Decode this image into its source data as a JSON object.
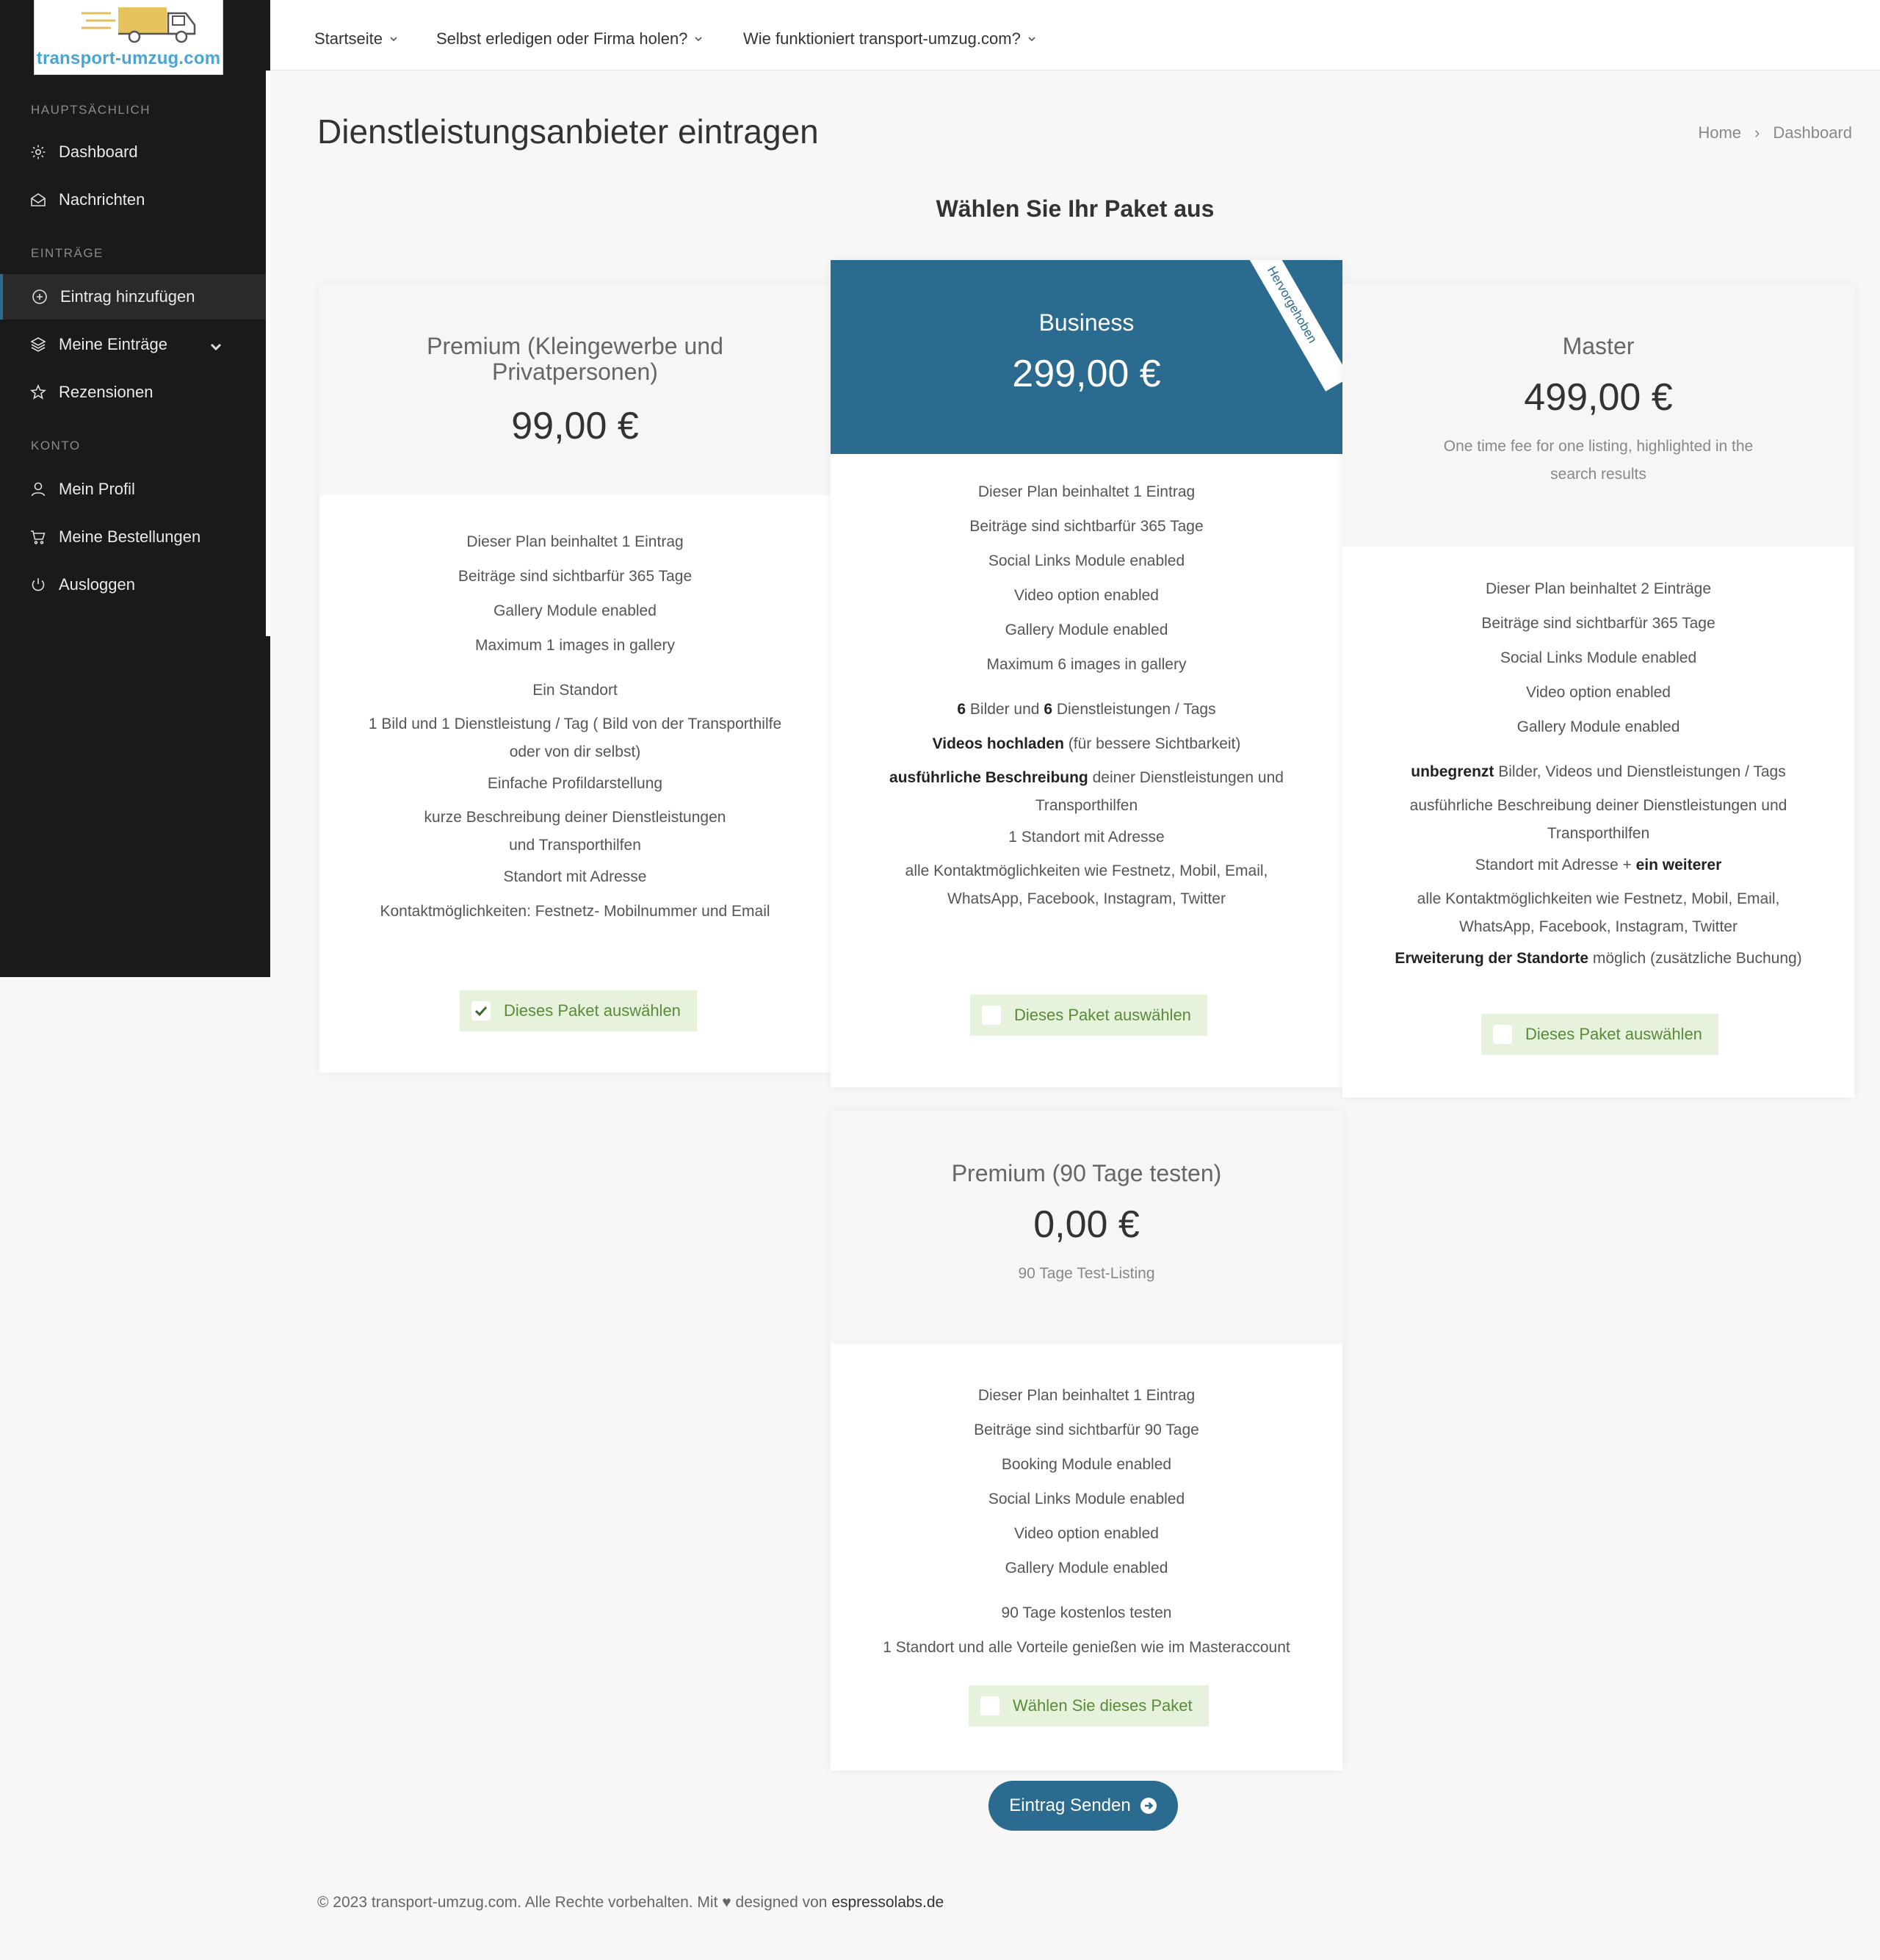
{
  "logo": {
    "text": "transport-umzug.com"
  },
  "sidebar": {
    "sections": {
      "main": "HAUPTSÄCHLICH",
      "entries": "EINTRÄGE",
      "account": "KONTO"
    },
    "items": {
      "dashboard": "Dashboard",
      "messages": "Nachrichten",
      "add_entry": "Eintrag hinzufügen",
      "my_entries": "Meine Einträge",
      "reviews": "Rezensionen",
      "profile": "Mein Profil",
      "orders": "Meine Bestellungen",
      "logout": "Ausloggen"
    }
  },
  "topnav": {
    "home": "Startseite",
    "diy": "Selbst erledigen oder Firma holen?",
    "how": "Wie funktioniert transport-umzug.com?"
  },
  "header": {
    "title": "Dienstleistungsanbieter eintragen",
    "breadcrumb_home": "Home",
    "breadcrumb_current": "Dashboard"
  },
  "section_title": "Wählen Sie Ihr Paket aus",
  "plans": {
    "premium": {
      "name_line1": "Premium (Kleingewerbe und",
      "name_line2": "Privatpersonen)",
      "price": "99,00 €",
      "f1": "Dieser Plan beinhaltet 1 Eintrag",
      "f2": "Beiträge sind sichtbarfür 365 Tage",
      "f3": "Gallery Module enabled",
      "f4": "Maximum 1 images in gallery",
      "f5": "Ein Standort",
      "f6a": "1 Bild und 1 Dienstleistung / Tag ( Bild von der Transporthilfe",
      "f6b": "oder von dir selbst)",
      "f7": "Einfache Profildarstellung",
      "f8a": "kurze Beschreibung deiner Dienstleistungen",
      "f8b": "und Transporthilfen",
      "f9": "Standort mit Adresse",
      "f10": "Kontaktmöglichkeiten: Festnetz- Mobilnummer und Email",
      "button": "Dieses Paket auswählen"
    },
    "business": {
      "ribbon": "Hervorgehoben",
      "name": "Business",
      "price": "299,00 €",
      "f1": "Dieser Plan beinhaltet 1 Eintrag",
      "f2": "Beiträge sind sichtbarfür 365 Tage",
      "f3": "Social Links Module enabled",
      "f4": "Video option enabled",
      "f5": "Gallery Module enabled",
      "f6": "Maximum 6 images in gallery",
      "f7_b1": "6",
      "f7_t1": " Bilder und ",
      "f7_b2": "6",
      "f7_t2": " Dienstleistungen / Tags",
      "f8_b": "Videos hochladen",
      "f8_t": " (für bessere Sichtbarkeit)",
      "f9_b": "ausführliche Beschreibung",
      "f9_t": " deiner Dienstleistungen und",
      "f9_t2": "Transporthilfen",
      "f10": "1 Standort mit Adresse",
      "f11a": "alle Kontaktmöglichkeiten wie Festnetz, Mobil, Email,",
      "f11b": "WhatsApp, Facebook, Instagram, Twitter",
      "button": "Dieses Paket auswählen"
    },
    "master": {
      "name": "Master",
      "price": "499,00 €",
      "desc1": "One time fee for one listing, highlighted in the",
      "desc2": "search results",
      "f1": "Dieser Plan beinhaltet 2 Einträge",
      "f2": "Beiträge sind sichtbarfür 365 Tage",
      "f3": "Social Links Module enabled",
      "f4": "Video option enabled",
      "f5": "Gallery Module enabled",
      "f6_b": "unbegrenzt",
      "f6_t": " Bilder, Videos und Dienstleistungen / Tags",
      "f7a": "ausführliche Beschreibung deiner Dienstleistungen und",
      "f7b": "Transporthilfen",
      "f8_t": "Standort mit Adresse + ",
      "f8_b": "ein weiterer",
      "f9a": "alle Kontaktmöglichkeiten wie Festnetz, Mobil, Email,",
      "f9b": "WhatsApp, Facebook, Instagram, Twitter",
      "f10_b": "Erweiterung der Standorte",
      "f10_t": " möglich (zusätzliche Buchung)",
      "button": "Dieses Paket auswählen"
    },
    "trial": {
      "name": "Premium (90 Tage testen)",
      "price": "0,00 €",
      "desc": "90 Tage Test-Listing",
      "f1": "Dieser Plan beinhaltet 1 Eintrag",
      "f2": "Beiträge sind sichtbarfür 90 Tage",
      "f3": "Booking Module enabled",
      "f4": "Social Links Module enabled",
      "f5": "Video option enabled",
      "f6": "Gallery Module enabled",
      "f7": "90 Tage kostenlos testen",
      "f8": "1 Standort und alle Vorteile genießen wie im Masteraccount",
      "button": "Wählen Sie dieses Paket"
    }
  },
  "submit": "Eintrag Senden",
  "footer": {
    "text": "© 2023 transport-umzug.com. Alle Rechte vorbehalten. Mit ♥ designed von ",
    "brand": "espressolabs.de"
  },
  "colors": {
    "accent": "#2b6b8f",
    "sidebar_bg": "#1a1a1a",
    "select_bg": "#e6f2dc",
    "select_text": "#5a8a3a",
    "logo_text": "#49a5d6"
  }
}
